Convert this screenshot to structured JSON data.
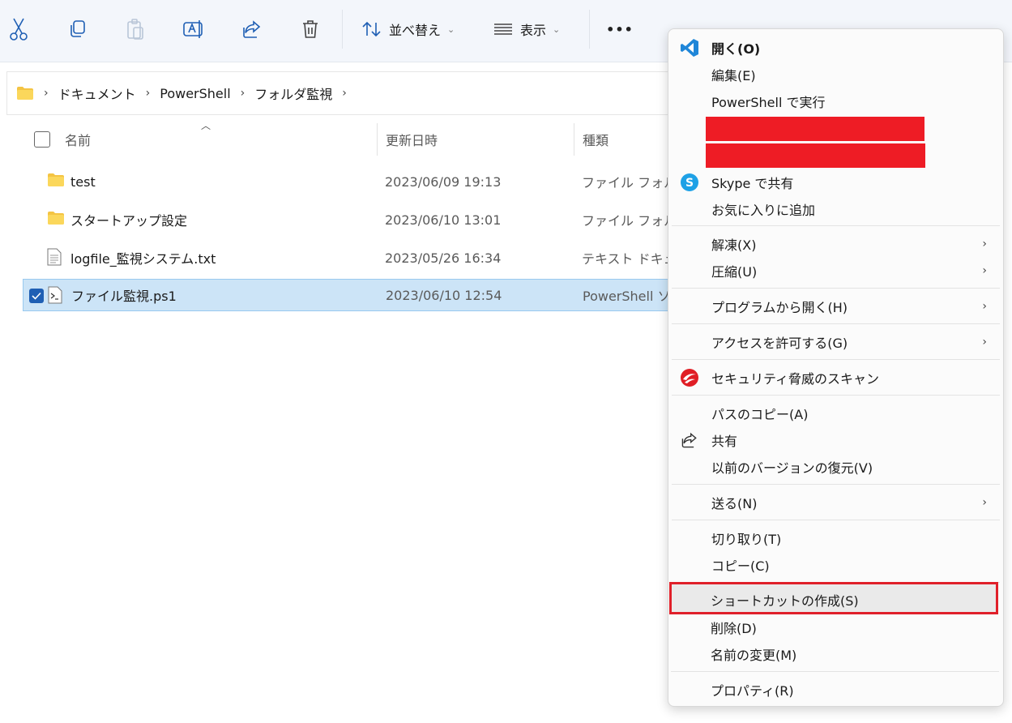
{
  "toolbar": {
    "buttons": [
      {
        "icon": "scissors-icon"
      },
      {
        "icon": "copy-icon"
      },
      {
        "icon": "paste-icon"
      },
      {
        "icon": "rename-icon"
      },
      {
        "icon": "share-icon"
      },
      {
        "icon": "trash-icon"
      }
    ],
    "sort_label": "並べ替え",
    "view_label": "表示",
    "more_label": "•••"
  },
  "breadcrumb": [
    "ドキュメント",
    "PowerShell",
    "フォルダ監視"
  ],
  "columns": {
    "name": "名前",
    "date": "更新日時",
    "type": "種類"
  },
  "files": [
    {
      "name": "test",
      "date": "2023/06/09 19:13",
      "type": "ファイル フォルダー",
      "icon": "folder-icon",
      "selected": false
    },
    {
      "name": "スタートアップ設定",
      "date": "2023/06/10 13:01",
      "type": "ファイル フォルダー",
      "icon": "folder-icon",
      "selected": false
    },
    {
      "name": "logfile_監視システム.txt",
      "date": "2023/05/26 16:34",
      "type": "テキスト ドキュメント",
      "icon": "text-file-icon",
      "selected": false
    },
    {
      "name": "ファイル監視.ps1",
      "date": "2023/06/10 12:54",
      "type": "PowerShell ソース",
      "icon": "powershell-file-icon",
      "selected": true
    }
  ],
  "menu": {
    "open": "開く(O)",
    "edit": "編集(E)",
    "run_powershell": "PowerShell で実行",
    "skype_share": "Skype で共有",
    "add_favorites": "お気に入りに追加",
    "extract": "解凍(X)",
    "compress": "圧縮(U)",
    "open_with": "プログラムから開く(H)",
    "give_access": "アクセスを許可する(G)",
    "security_scan": "セキュリティ脅威のスキャン",
    "copy_path": "パスのコピー(A)",
    "share": "共有",
    "restore_versions": "以前のバージョンの復元(V)",
    "send_to": "送る(N)",
    "cut": "切り取り(T)",
    "copy": "コピー(C)",
    "create_shortcut": "ショートカットの作成(S)",
    "delete": "削除(D)",
    "rename": "名前の変更(M)",
    "properties": "プロパティ(R)",
    "submenu_arrow": "›"
  },
  "colors": {
    "accent": "#1f5fb4",
    "selection": "#cce4f7",
    "highlight_border": "#e0202a",
    "redaction": "#ee1c25"
  }
}
